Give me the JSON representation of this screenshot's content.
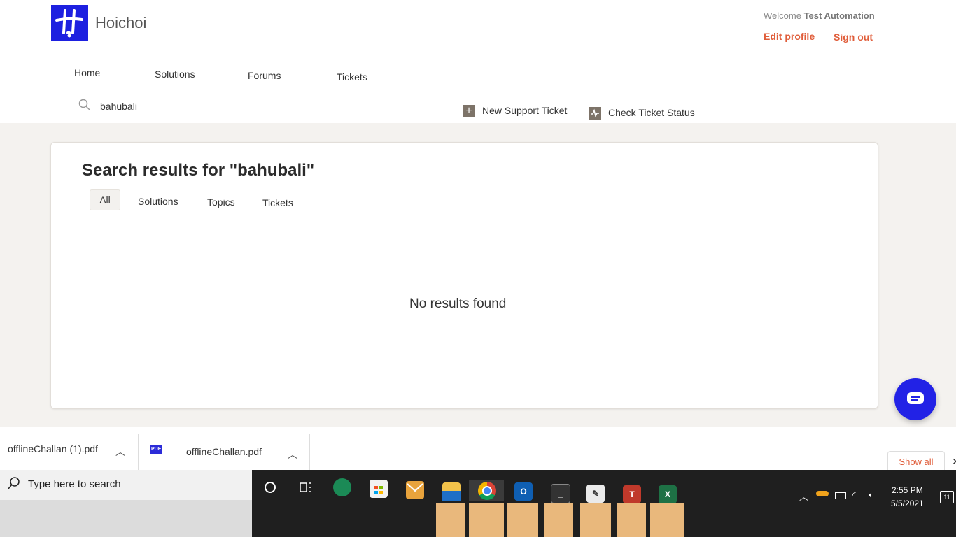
{
  "header": {
    "brand_name": "Hoichoi",
    "welcome_label": "Welcome",
    "user_name": "Test Automation",
    "edit_profile": "Edit profile",
    "sign_out": "Sign out",
    "accent_color": "#e05d3a",
    "logo_color": "#1d20e0"
  },
  "nav": {
    "items": [
      {
        "label": "Home"
      },
      {
        "label": "Solutions"
      },
      {
        "label": "Forums"
      },
      {
        "label": "Tickets"
      }
    ]
  },
  "search": {
    "value": "bahubali",
    "icon": "search-icon"
  },
  "actions": {
    "new_ticket": "New Support Ticket",
    "check_status": "Check Ticket Status"
  },
  "results": {
    "title": "Search results for \"bahubali\"",
    "tabs": [
      {
        "label": "All",
        "active": true
      },
      {
        "label": "Solutions"
      },
      {
        "label": "Topics"
      },
      {
        "label": "Tickets"
      }
    ],
    "empty_message": "No results found"
  },
  "chat": {
    "icon": "chat-bubble-icon",
    "color": "#2222e6"
  },
  "downloads": {
    "items": [
      {
        "filename": "offlineChallan (1).pdf"
      },
      {
        "filename": "offlineChallan.pdf",
        "icon_label": "PDF"
      }
    ],
    "show_all": "Show all",
    "close": "✕"
  },
  "taskbar": {
    "search_placeholder": "Type here to search",
    "apps": [
      "cortana-icon",
      "task-view-icon",
      "edge-icon",
      "store-icon",
      "mail-icon",
      "file-explorer-icon",
      "chrome-icon",
      "outlook-icon",
      "terminal-icon",
      "notepad-icon",
      "teams-icon",
      "excel-icon"
    ],
    "clock_time": "2:55 PM",
    "clock_date": "5/5/2021",
    "notification_count": "11"
  }
}
